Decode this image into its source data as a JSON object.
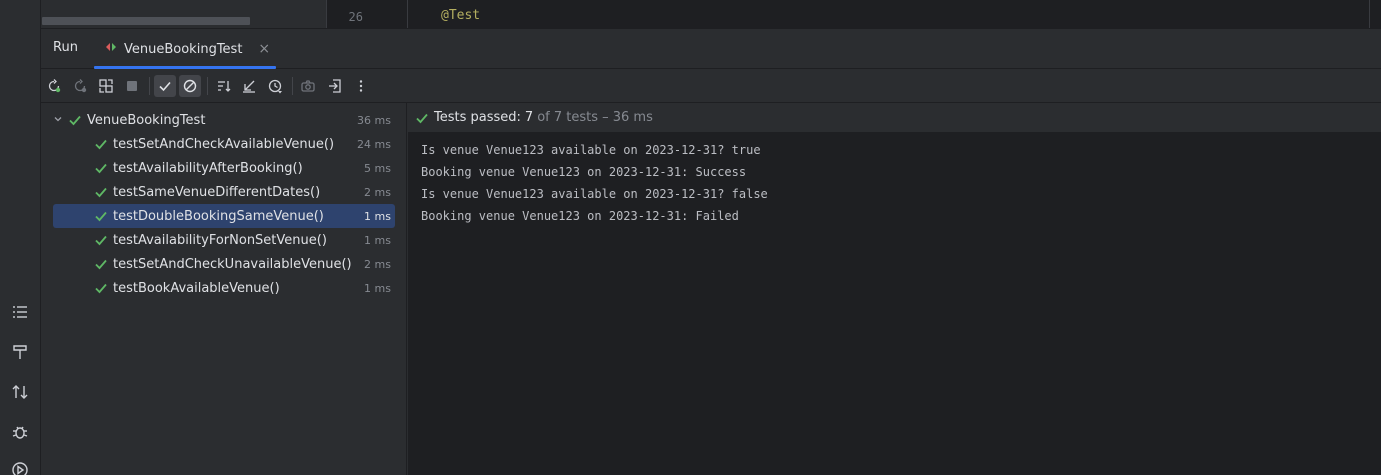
{
  "editor": {
    "line_number": "26",
    "code_text": "@Test"
  },
  "toolwindow": {
    "title": "Run",
    "tab_label": "VenueBookingTest",
    "tab_close": "×"
  },
  "tree": {
    "root": {
      "name": "VenueBookingTest",
      "duration": "36 ms"
    },
    "items": [
      {
        "name": "testSetAndCheckAvailableVenue()",
        "duration": "24 ms",
        "selected": false
      },
      {
        "name": "testAvailabilityAfterBooking()",
        "duration": "5 ms",
        "selected": false
      },
      {
        "name": "testSameVenueDifferentDates()",
        "duration": "2 ms",
        "selected": false
      },
      {
        "name": "testDoubleBookingSameVenue()",
        "duration": "1 ms",
        "selected": true
      },
      {
        "name": "testAvailabilityForNonSetVenue()",
        "duration": "1 ms",
        "selected": false
      },
      {
        "name": "testSetAndCheckUnavailableVenue()",
        "duration": "2 ms",
        "selected": false
      },
      {
        "name": "testBookAvailableVenue()",
        "duration": "1 ms",
        "selected": false
      }
    ]
  },
  "status": {
    "label": "Tests passed:",
    "count": "7",
    "rest": "of 7 tests – 36 ms"
  },
  "console": {
    "lines": [
      "Is venue Venue123 available on 2023-12-31? true",
      "Booking venue Venue123 on 2023-12-31: Success",
      "Is venue Venue123 available on 2023-12-31? false",
      "Booking venue Venue123 on 2023-12-31: Failed"
    ]
  },
  "colors": {
    "accent": "#3574f0",
    "success": "#5fb865",
    "selection": "#2e436e"
  }
}
